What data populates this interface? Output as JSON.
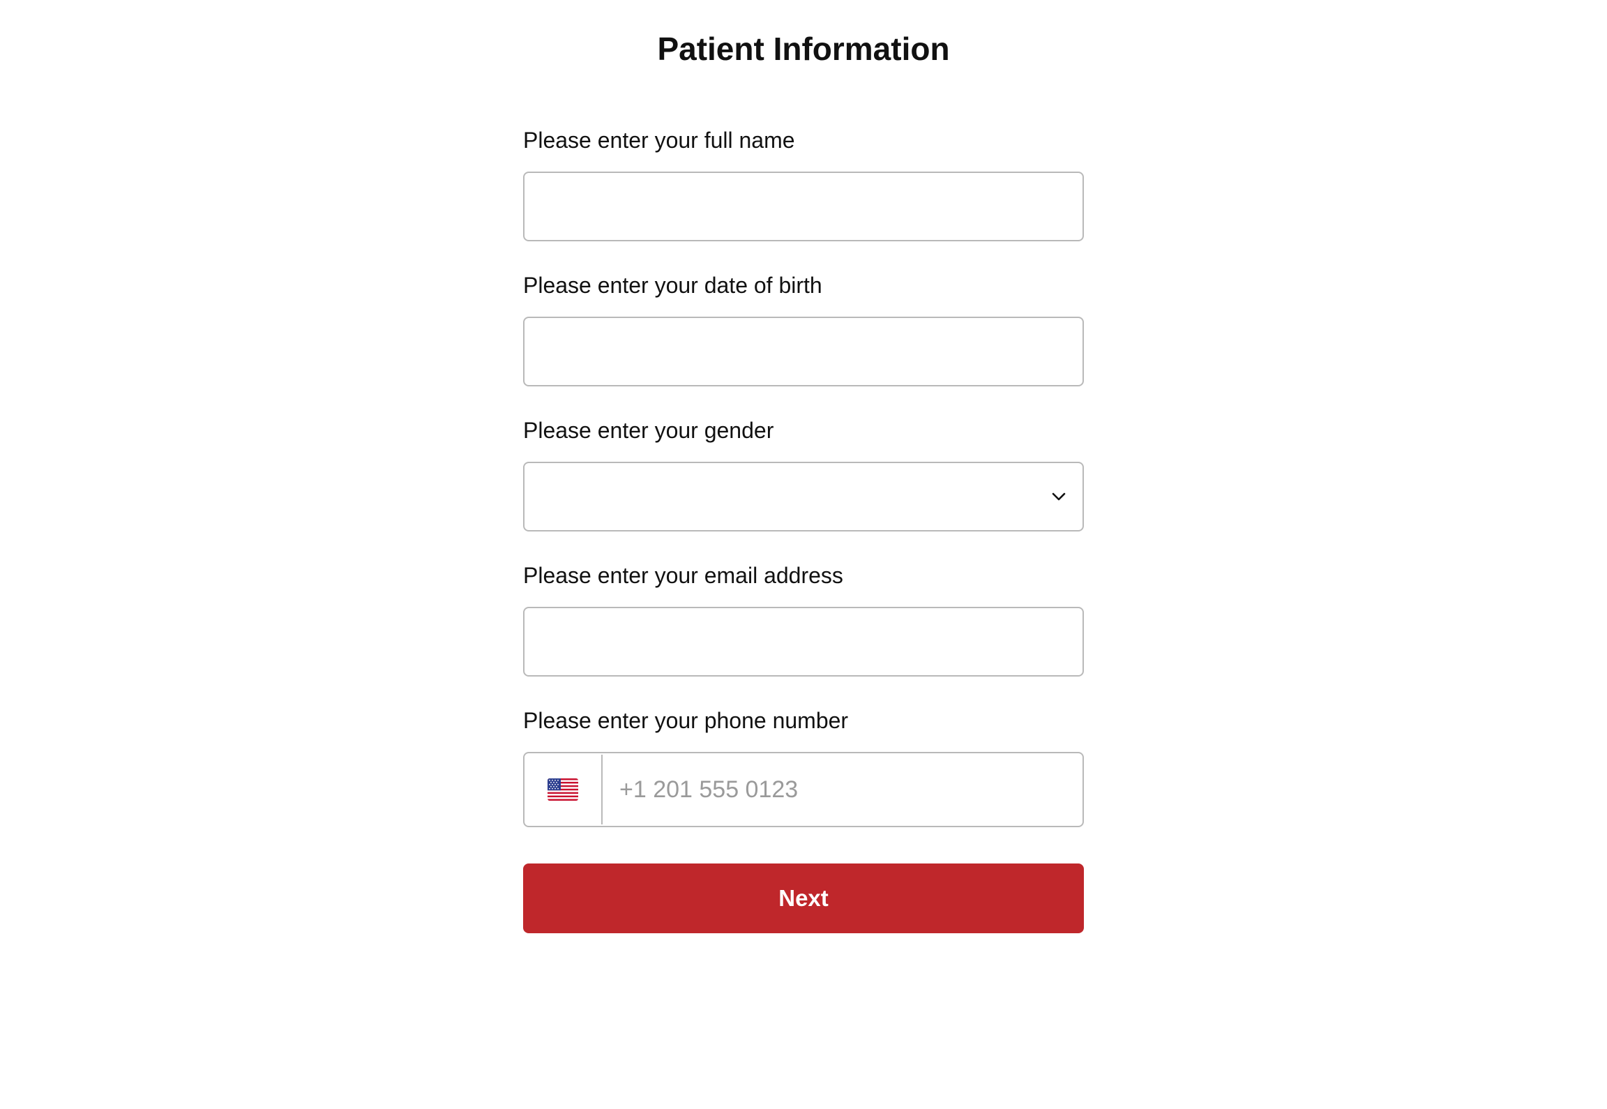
{
  "page": {
    "title": "Patient Information"
  },
  "form": {
    "full_name": {
      "label": "Please enter your full name",
      "value": "",
      "placeholder": ""
    },
    "date_of_birth": {
      "label": "Please enter your date of birth",
      "value": "",
      "placeholder": ""
    },
    "gender": {
      "label": "Please enter your gender",
      "selected": "",
      "icon": "chevron-down-icon"
    },
    "email": {
      "label": "Please enter your email address",
      "value": "",
      "placeholder": ""
    },
    "phone": {
      "label": "Please enter your phone number",
      "country_icon": "us-flag-icon",
      "value": "",
      "placeholder": "+1 201 555 0123"
    },
    "next_button": {
      "label": "Next",
      "color": "#bf272b"
    }
  }
}
